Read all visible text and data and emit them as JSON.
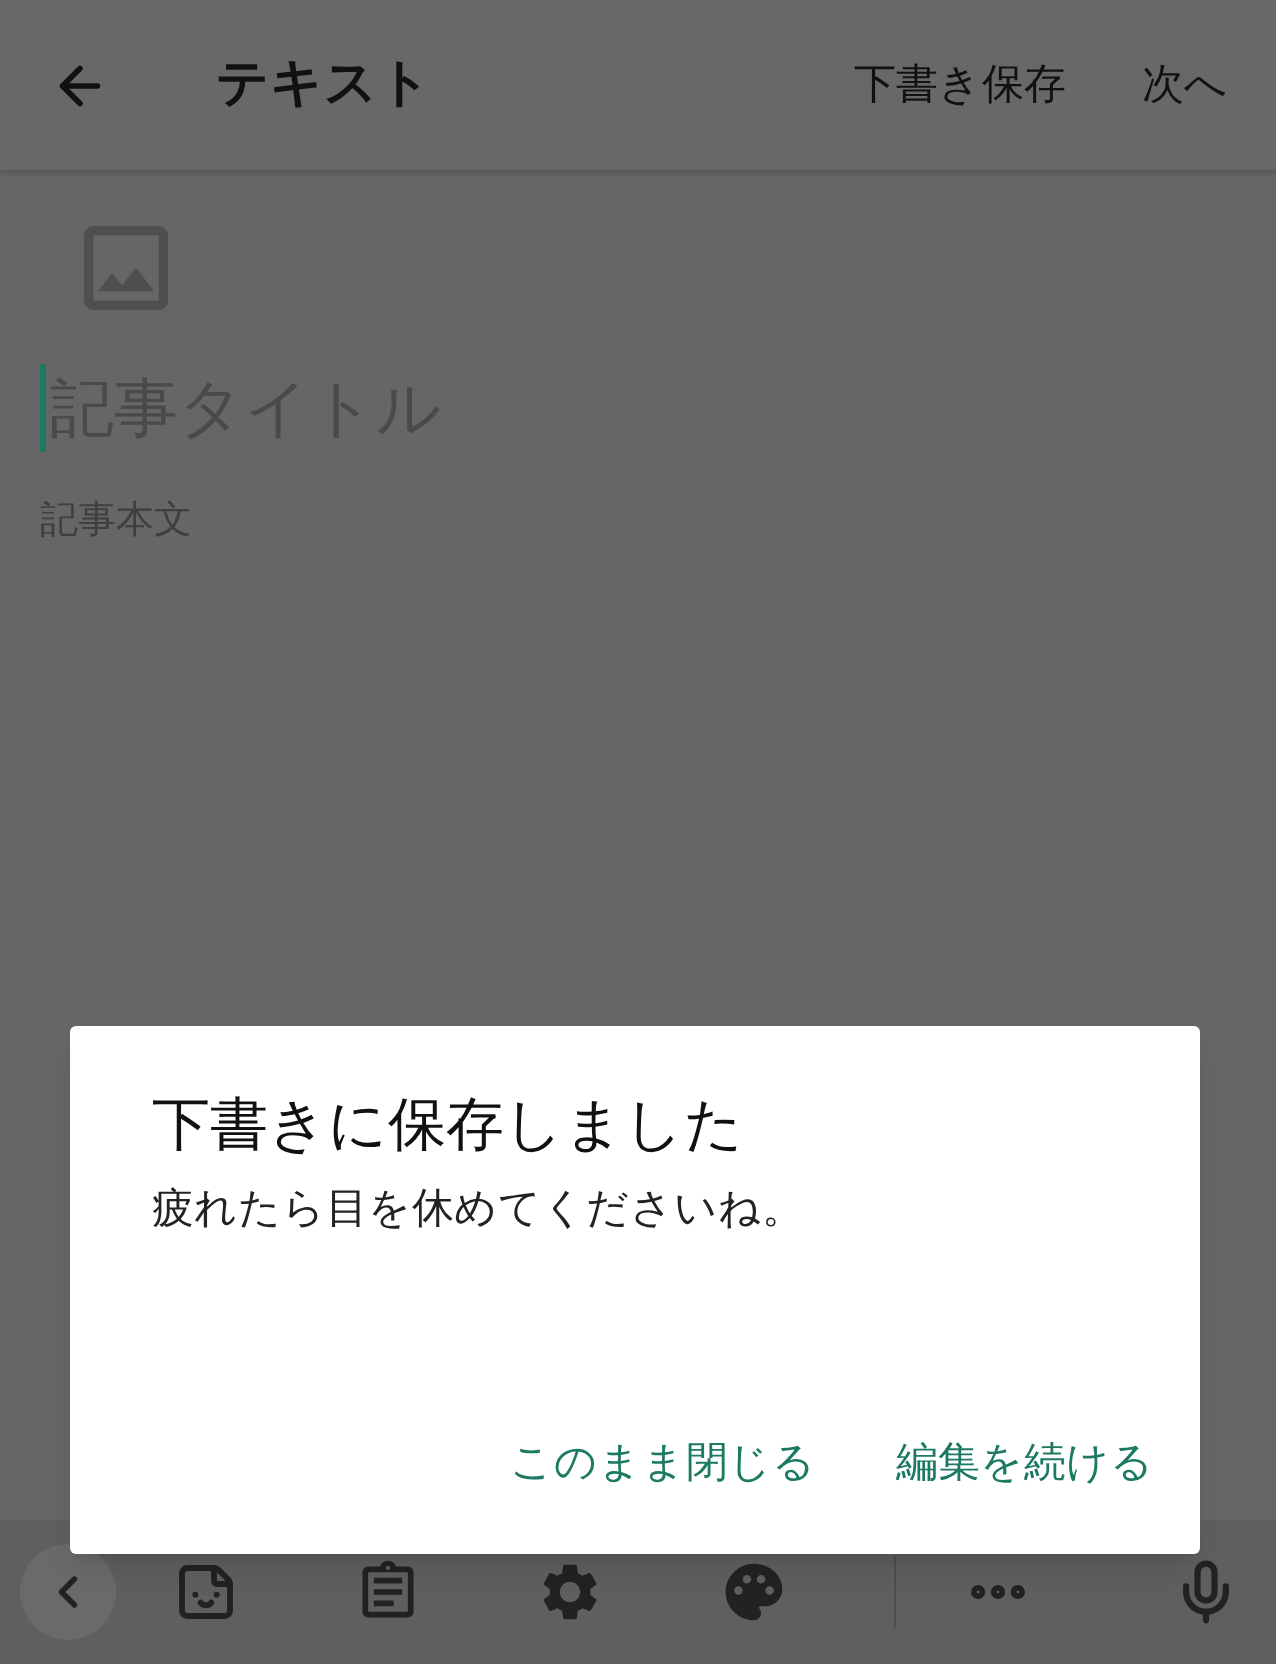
{
  "header": {
    "title": "テキスト",
    "save_draft": "下書き保存",
    "next": "次へ"
  },
  "editor": {
    "title_placeholder": "記事タイトル",
    "body_placeholder": "記事本文"
  },
  "dialog": {
    "title": "下書きに保存しました",
    "message": "疲れたら目を休めてくださいね。",
    "buttons": [
      "このまま閉じる",
      "編集を続ける"
    ]
  }
}
